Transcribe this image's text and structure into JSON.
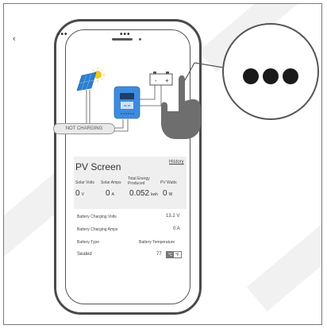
{
  "colors": {
    "frame": "#777777",
    "phone": "#4a4a4a",
    "card": "#efefef",
    "panel": "#2a7fd0",
    "hand": "#6e6e6e"
  },
  "nav": {
    "back_icon": "chevron-left-icon",
    "more_icon": "ellipsis-icon",
    "options_icon": "ellipsis-icon"
  },
  "status": {
    "label": "NOT CHARGING"
  },
  "pv": {
    "title": "PV Screen",
    "history_label": "History",
    "columns": [
      {
        "label": "Solar Volts",
        "value": "0",
        "unit": "V"
      },
      {
        "label": "Solar Amps",
        "value": "0",
        "unit": "A"
      },
      {
        "label": "Total Energy Produced",
        "value": "0.052",
        "unit": "kwh"
      },
      {
        "label": "PV Watts",
        "value": "0",
        "unit": "W"
      }
    ]
  },
  "battery": {
    "charging_volts_label": "Battery  Charging  Volts",
    "charging_volts_value": "13.2 V",
    "charging_amps_label": "Battery  Charging  Amps",
    "charging_amps_value": "0 A",
    "type_label": "Battery  Type",
    "temperature_label": "Battery  Temperature",
    "type_value": "Sealed",
    "temperature_value": "77",
    "unit_c": "°C",
    "unit_f": "°F"
  },
  "callout": {
    "icon": "ellipsis-icon"
  }
}
